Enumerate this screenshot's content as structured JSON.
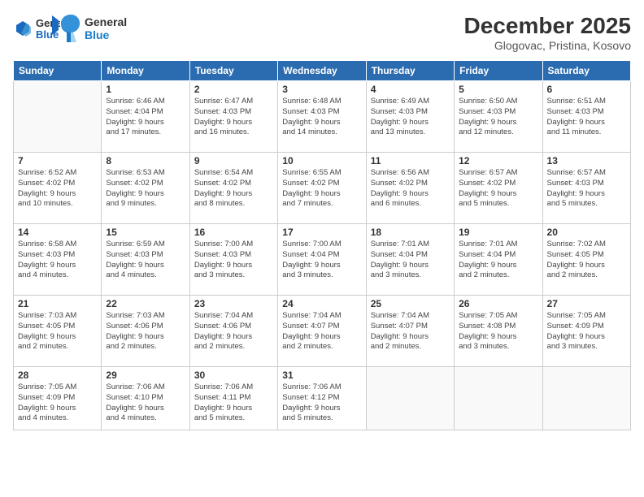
{
  "logo": {
    "general": "General",
    "blue": "Blue"
  },
  "header": {
    "month": "December 2025",
    "location": "Glogovac, Pristina, Kosovo"
  },
  "weekdays": [
    "Sunday",
    "Monday",
    "Tuesday",
    "Wednesday",
    "Thursday",
    "Friday",
    "Saturday"
  ],
  "weeks": [
    [
      {
        "day": "",
        "info": ""
      },
      {
        "day": "1",
        "info": "Sunrise: 6:46 AM\nSunset: 4:04 PM\nDaylight: 9 hours\nand 17 minutes."
      },
      {
        "day": "2",
        "info": "Sunrise: 6:47 AM\nSunset: 4:03 PM\nDaylight: 9 hours\nand 16 minutes."
      },
      {
        "day": "3",
        "info": "Sunrise: 6:48 AM\nSunset: 4:03 PM\nDaylight: 9 hours\nand 14 minutes."
      },
      {
        "day": "4",
        "info": "Sunrise: 6:49 AM\nSunset: 4:03 PM\nDaylight: 9 hours\nand 13 minutes."
      },
      {
        "day": "5",
        "info": "Sunrise: 6:50 AM\nSunset: 4:03 PM\nDaylight: 9 hours\nand 12 minutes."
      },
      {
        "day": "6",
        "info": "Sunrise: 6:51 AM\nSunset: 4:03 PM\nDaylight: 9 hours\nand 11 minutes."
      }
    ],
    [
      {
        "day": "7",
        "info": "Sunrise: 6:52 AM\nSunset: 4:02 PM\nDaylight: 9 hours\nand 10 minutes."
      },
      {
        "day": "8",
        "info": "Sunrise: 6:53 AM\nSunset: 4:02 PM\nDaylight: 9 hours\nand 9 minutes."
      },
      {
        "day": "9",
        "info": "Sunrise: 6:54 AM\nSunset: 4:02 PM\nDaylight: 9 hours\nand 8 minutes."
      },
      {
        "day": "10",
        "info": "Sunrise: 6:55 AM\nSunset: 4:02 PM\nDaylight: 9 hours\nand 7 minutes."
      },
      {
        "day": "11",
        "info": "Sunrise: 6:56 AM\nSunset: 4:02 PM\nDaylight: 9 hours\nand 6 minutes."
      },
      {
        "day": "12",
        "info": "Sunrise: 6:57 AM\nSunset: 4:02 PM\nDaylight: 9 hours\nand 5 minutes."
      },
      {
        "day": "13",
        "info": "Sunrise: 6:57 AM\nSunset: 4:03 PM\nDaylight: 9 hours\nand 5 minutes."
      }
    ],
    [
      {
        "day": "14",
        "info": "Sunrise: 6:58 AM\nSunset: 4:03 PM\nDaylight: 9 hours\nand 4 minutes."
      },
      {
        "day": "15",
        "info": "Sunrise: 6:59 AM\nSunset: 4:03 PM\nDaylight: 9 hours\nand 4 minutes."
      },
      {
        "day": "16",
        "info": "Sunrise: 7:00 AM\nSunset: 4:03 PM\nDaylight: 9 hours\nand 3 minutes."
      },
      {
        "day": "17",
        "info": "Sunrise: 7:00 AM\nSunset: 4:04 PM\nDaylight: 9 hours\nand 3 minutes."
      },
      {
        "day": "18",
        "info": "Sunrise: 7:01 AM\nSunset: 4:04 PM\nDaylight: 9 hours\nand 3 minutes."
      },
      {
        "day": "19",
        "info": "Sunrise: 7:01 AM\nSunset: 4:04 PM\nDaylight: 9 hours\nand 2 minutes."
      },
      {
        "day": "20",
        "info": "Sunrise: 7:02 AM\nSunset: 4:05 PM\nDaylight: 9 hours\nand 2 minutes."
      }
    ],
    [
      {
        "day": "21",
        "info": "Sunrise: 7:03 AM\nSunset: 4:05 PM\nDaylight: 9 hours\nand 2 minutes."
      },
      {
        "day": "22",
        "info": "Sunrise: 7:03 AM\nSunset: 4:06 PM\nDaylight: 9 hours\nand 2 minutes."
      },
      {
        "day": "23",
        "info": "Sunrise: 7:04 AM\nSunset: 4:06 PM\nDaylight: 9 hours\nand 2 minutes."
      },
      {
        "day": "24",
        "info": "Sunrise: 7:04 AM\nSunset: 4:07 PM\nDaylight: 9 hours\nand 2 minutes."
      },
      {
        "day": "25",
        "info": "Sunrise: 7:04 AM\nSunset: 4:07 PM\nDaylight: 9 hours\nand 2 minutes."
      },
      {
        "day": "26",
        "info": "Sunrise: 7:05 AM\nSunset: 4:08 PM\nDaylight: 9 hours\nand 3 minutes."
      },
      {
        "day": "27",
        "info": "Sunrise: 7:05 AM\nSunset: 4:09 PM\nDaylight: 9 hours\nand 3 minutes."
      }
    ],
    [
      {
        "day": "28",
        "info": "Sunrise: 7:05 AM\nSunset: 4:09 PM\nDaylight: 9 hours\nand 4 minutes."
      },
      {
        "day": "29",
        "info": "Sunrise: 7:06 AM\nSunset: 4:10 PM\nDaylight: 9 hours\nand 4 minutes."
      },
      {
        "day": "30",
        "info": "Sunrise: 7:06 AM\nSunset: 4:11 PM\nDaylight: 9 hours\nand 5 minutes."
      },
      {
        "day": "31",
        "info": "Sunrise: 7:06 AM\nSunset: 4:12 PM\nDaylight: 9 hours\nand 5 minutes."
      },
      {
        "day": "",
        "info": ""
      },
      {
        "day": "",
        "info": ""
      },
      {
        "day": "",
        "info": ""
      }
    ]
  ]
}
